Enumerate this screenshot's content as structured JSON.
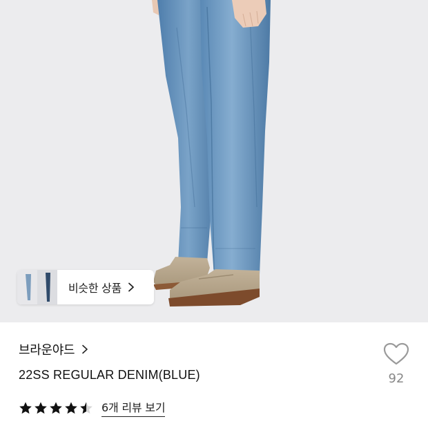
{
  "product_image": {
    "alt": ""
  },
  "similar_products": {
    "label": "비슷한 상품",
    "arrow_icon": "chevron-right-icon"
  },
  "brand": {
    "name": "브라운야드",
    "arrow_icon": "chevron-right-icon"
  },
  "product": {
    "name": "22SS REGULAR DENIM(BLUE)"
  },
  "rating": {
    "stars": 4.5,
    "max": 5,
    "review_link": "6개 리뷰 보기"
  },
  "like": {
    "icon": "heart-outline-icon",
    "count": "92"
  },
  "colors": {
    "photo_bg": "#ececee",
    "denim": "#5b88b4",
    "shoe": "#b5a48a",
    "text": "#111111",
    "muted": "#888888"
  }
}
